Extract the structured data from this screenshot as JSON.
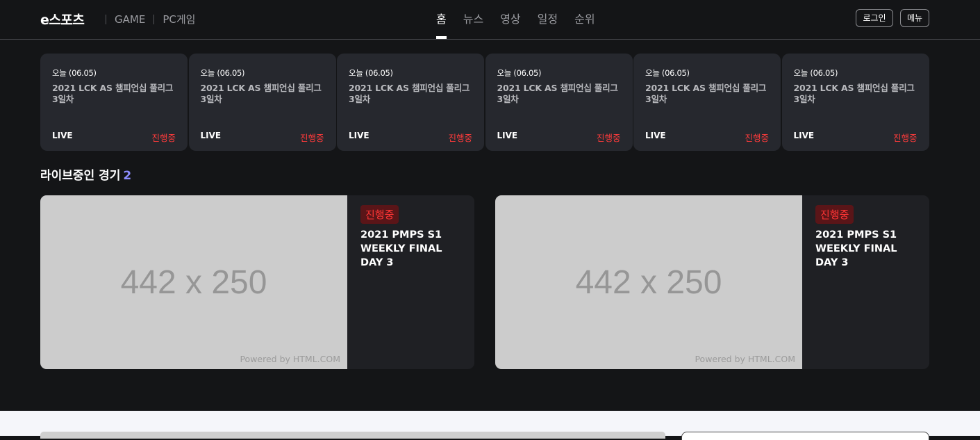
{
  "header": {
    "logo": "e스포츠",
    "categories": [
      "GAME",
      "PC게임"
    ],
    "tabs": [
      {
        "label": "홈",
        "active": true
      },
      {
        "label": "뉴스",
        "active": false
      },
      {
        "label": "영상",
        "active": false
      },
      {
        "label": "일정",
        "active": false
      },
      {
        "label": "순위",
        "active": false
      }
    ],
    "login_label": "로그인",
    "menu_label": "메뉴"
  },
  "schedule": [
    {
      "date": "오늘 (06.05)",
      "title": "2021 LCK AS 챔피언십 풀리그 3일차",
      "live": "LIVE",
      "status": "진행중"
    },
    {
      "date": "오늘 (06.05)",
      "title": "2021 LCK AS 챔피언십 풀리그 3일차",
      "live": "LIVE",
      "status": "진행중"
    },
    {
      "date": "오늘 (06.05)",
      "title": "2021 LCK AS 챔피언십 풀리그 3일차",
      "live": "LIVE",
      "status": "진행중"
    },
    {
      "date": "오늘 (06.05)",
      "title": "2021 LCK AS 챔피언십 풀리그 3일차",
      "live": "LIVE",
      "status": "진행중"
    },
    {
      "date": "오늘 (06.05)",
      "title": "2021 LCK AS 챔피언십 풀리그 3일차",
      "live": "LIVE",
      "status": "진행중"
    },
    {
      "date": "오늘 (06.05)",
      "title": "2021 LCK AS 챔피언십 풀리그 3일차",
      "live": "LIVE",
      "status": "진행중"
    }
  ],
  "live_section": {
    "title": "라이브중인 경기",
    "count": "2",
    "cards": [
      {
        "thumb_text": "442 x 250",
        "powered": "Powered by HTML.COM",
        "badge": "진행중",
        "title": "2021 PMPS S1 WEEKLY FINAL DAY 3"
      },
      {
        "thumb_text": "442 x 250",
        "powered": "Powered by HTML.COM",
        "badge": "진행중",
        "title": "2021 PMPS S1 WEEKLY FINAL DAY 3"
      }
    ]
  },
  "colors": {
    "background": "#141517",
    "card": "#26282e",
    "status_red": "#ff3b3b",
    "count_accent": "#8d8dff"
  }
}
